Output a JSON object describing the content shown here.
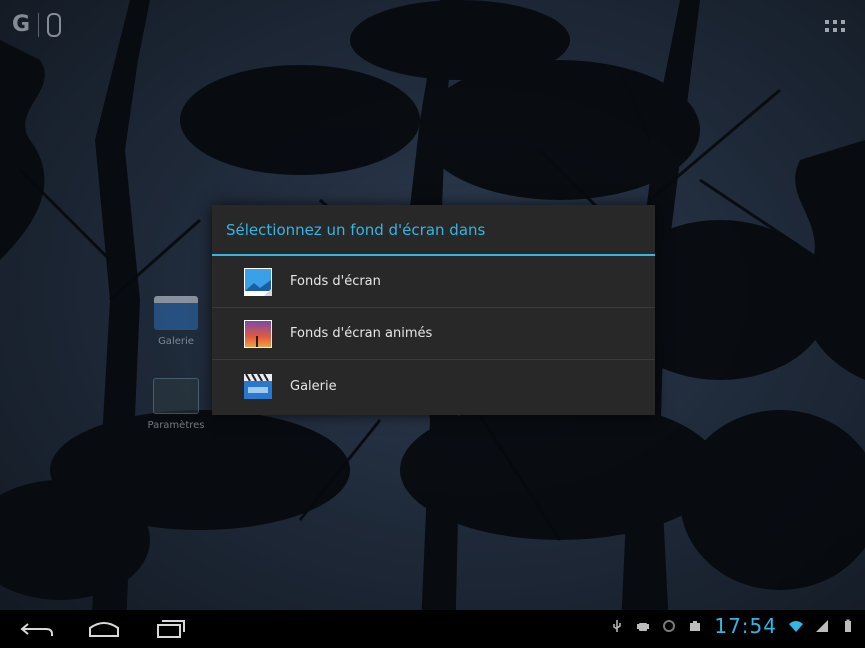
{
  "dialog": {
    "title": "Sélectionnez un fond d'écran dans",
    "options": [
      {
        "label": "Fonds d'écran",
        "icon": "wallpaper-icon"
      },
      {
        "label": "Fonds d'écran animés",
        "icon": "live-wallpaper-icon"
      },
      {
        "label": "Galerie",
        "icon": "gallery-icon"
      }
    ]
  },
  "home": {
    "icons": [
      {
        "label": "Galerie",
        "icon": "gallery-icon"
      },
      {
        "label": "Paramètres",
        "icon": "settings-icon"
      }
    ]
  },
  "statusbar": {
    "time": "17:54"
  },
  "colors": {
    "accent": "#33b5e5",
    "dialog_bg": "#282828",
    "navbar_bg": "#000000"
  }
}
